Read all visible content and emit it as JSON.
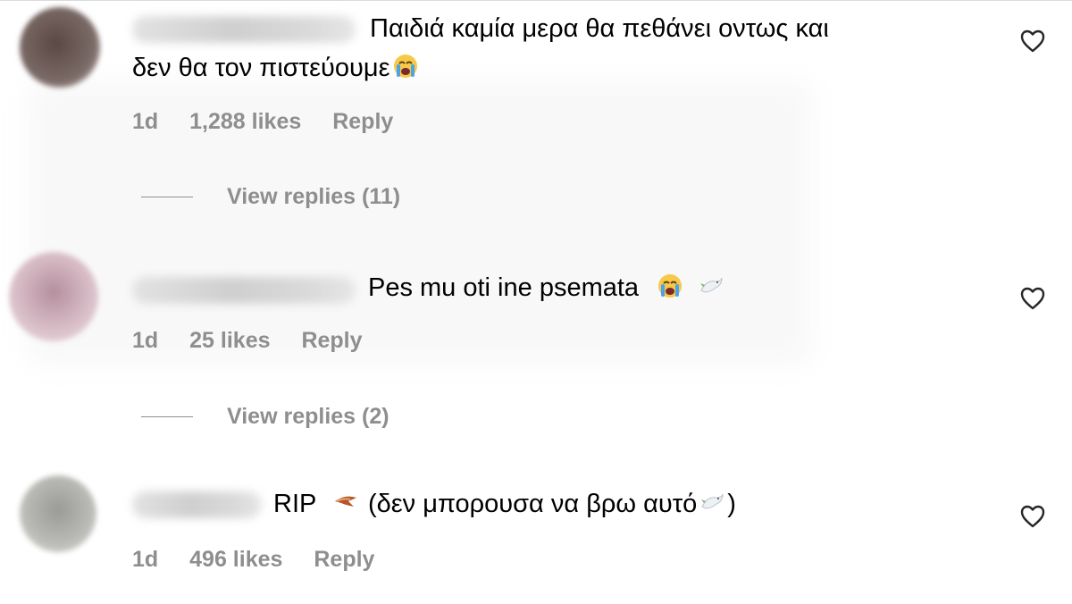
{
  "comments": [
    {
      "text_line1": "Παιδιά καμία μερα θα πεθάνει οντως και",
      "text_line2": "δεν θα τον πιστεύουμε",
      "time": "1d",
      "likes": "1,288 likes",
      "reply_label": "Reply",
      "view_replies": "View replies (11)",
      "avatar_color": "#6a5a55"
    },
    {
      "text": "Pes mu oti ine psemata",
      "time": "1d",
      "likes": "25 likes",
      "reply_label": "Reply",
      "view_replies": "View replies (2)",
      "avatar_color": "#c9a7b3"
    },
    {
      "text_prefix": "RIP",
      "text_main": "(δεν μπορουσα να βρω αυτό",
      "text_suffix": ")",
      "time": "1d",
      "likes": "496 likes",
      "reply_label": "Reply",
      "avatar_color": "#a9a9a4"
    }
  ],
  "icons": {
    "like": "heart-outline-icon",
    "crying": "loudly-crying-face-emoji",
    "dove": "dove-emoji",
    "bird": "bird-emoji"
  },
  "colors": {
    "meta": "#8e8e8e",
    "text": "#000000"
  }
}
